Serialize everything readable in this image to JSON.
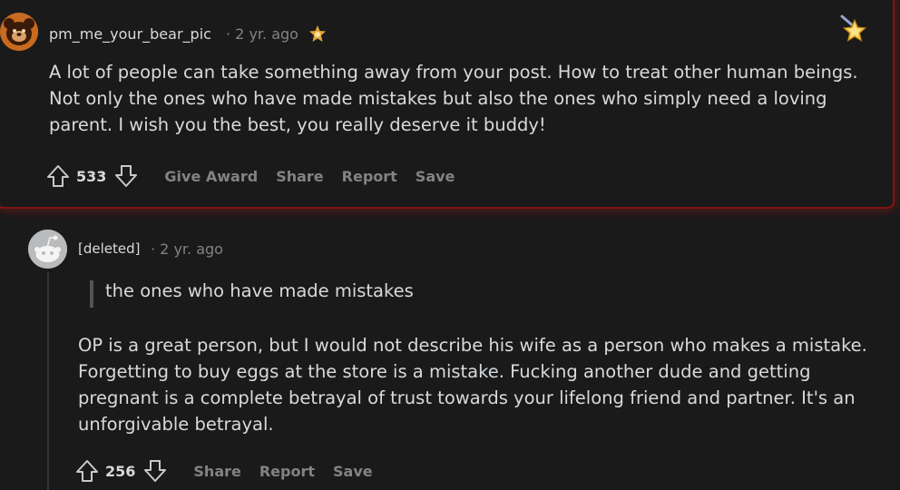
{
  "comment1": {
    "username": "pm_me_your_bear_pic",
    "time": "· 2 yr. ago",
    "text": "A lot of people can take something away from your post. How to treat other human beings. Not only the ones who have made mistakes but also the ones who simply need a loving parent. I wish you the best, you really deserve it buddy!",
    "votes": "533",
    "actions": {
      "give_award": "Give Award",
      "share": "Share",
      "report": "Report",
      "save": "Save"
    },
    "highlight_color": "#a31b1b",
    "avatar_icon": "bear-avatar-icon",
    "award_icon": "star-award-icon"
  },
  "comment2": {
    "username": "[deleted]",
    "time": "· 2 yr. ago",
    "quote": "the ones who have made mistakes",
    "text": "OP is a great person, but I would not describe his wife as a person who makes a mistake. Forgetting to buy eggs at the store is a mistake. Fucking another dude and getting pregnant is a complete betrayal of trust towards your lifelong friend and partner. It's an unforgivable betrayal.",
    "votes": "256",
    "actions": {
      "share": "Share",
      "report": "Report",
      "save": "Save"
    },
    "avatar_icon": "default-snoo-avatar-icon"
  }
}
